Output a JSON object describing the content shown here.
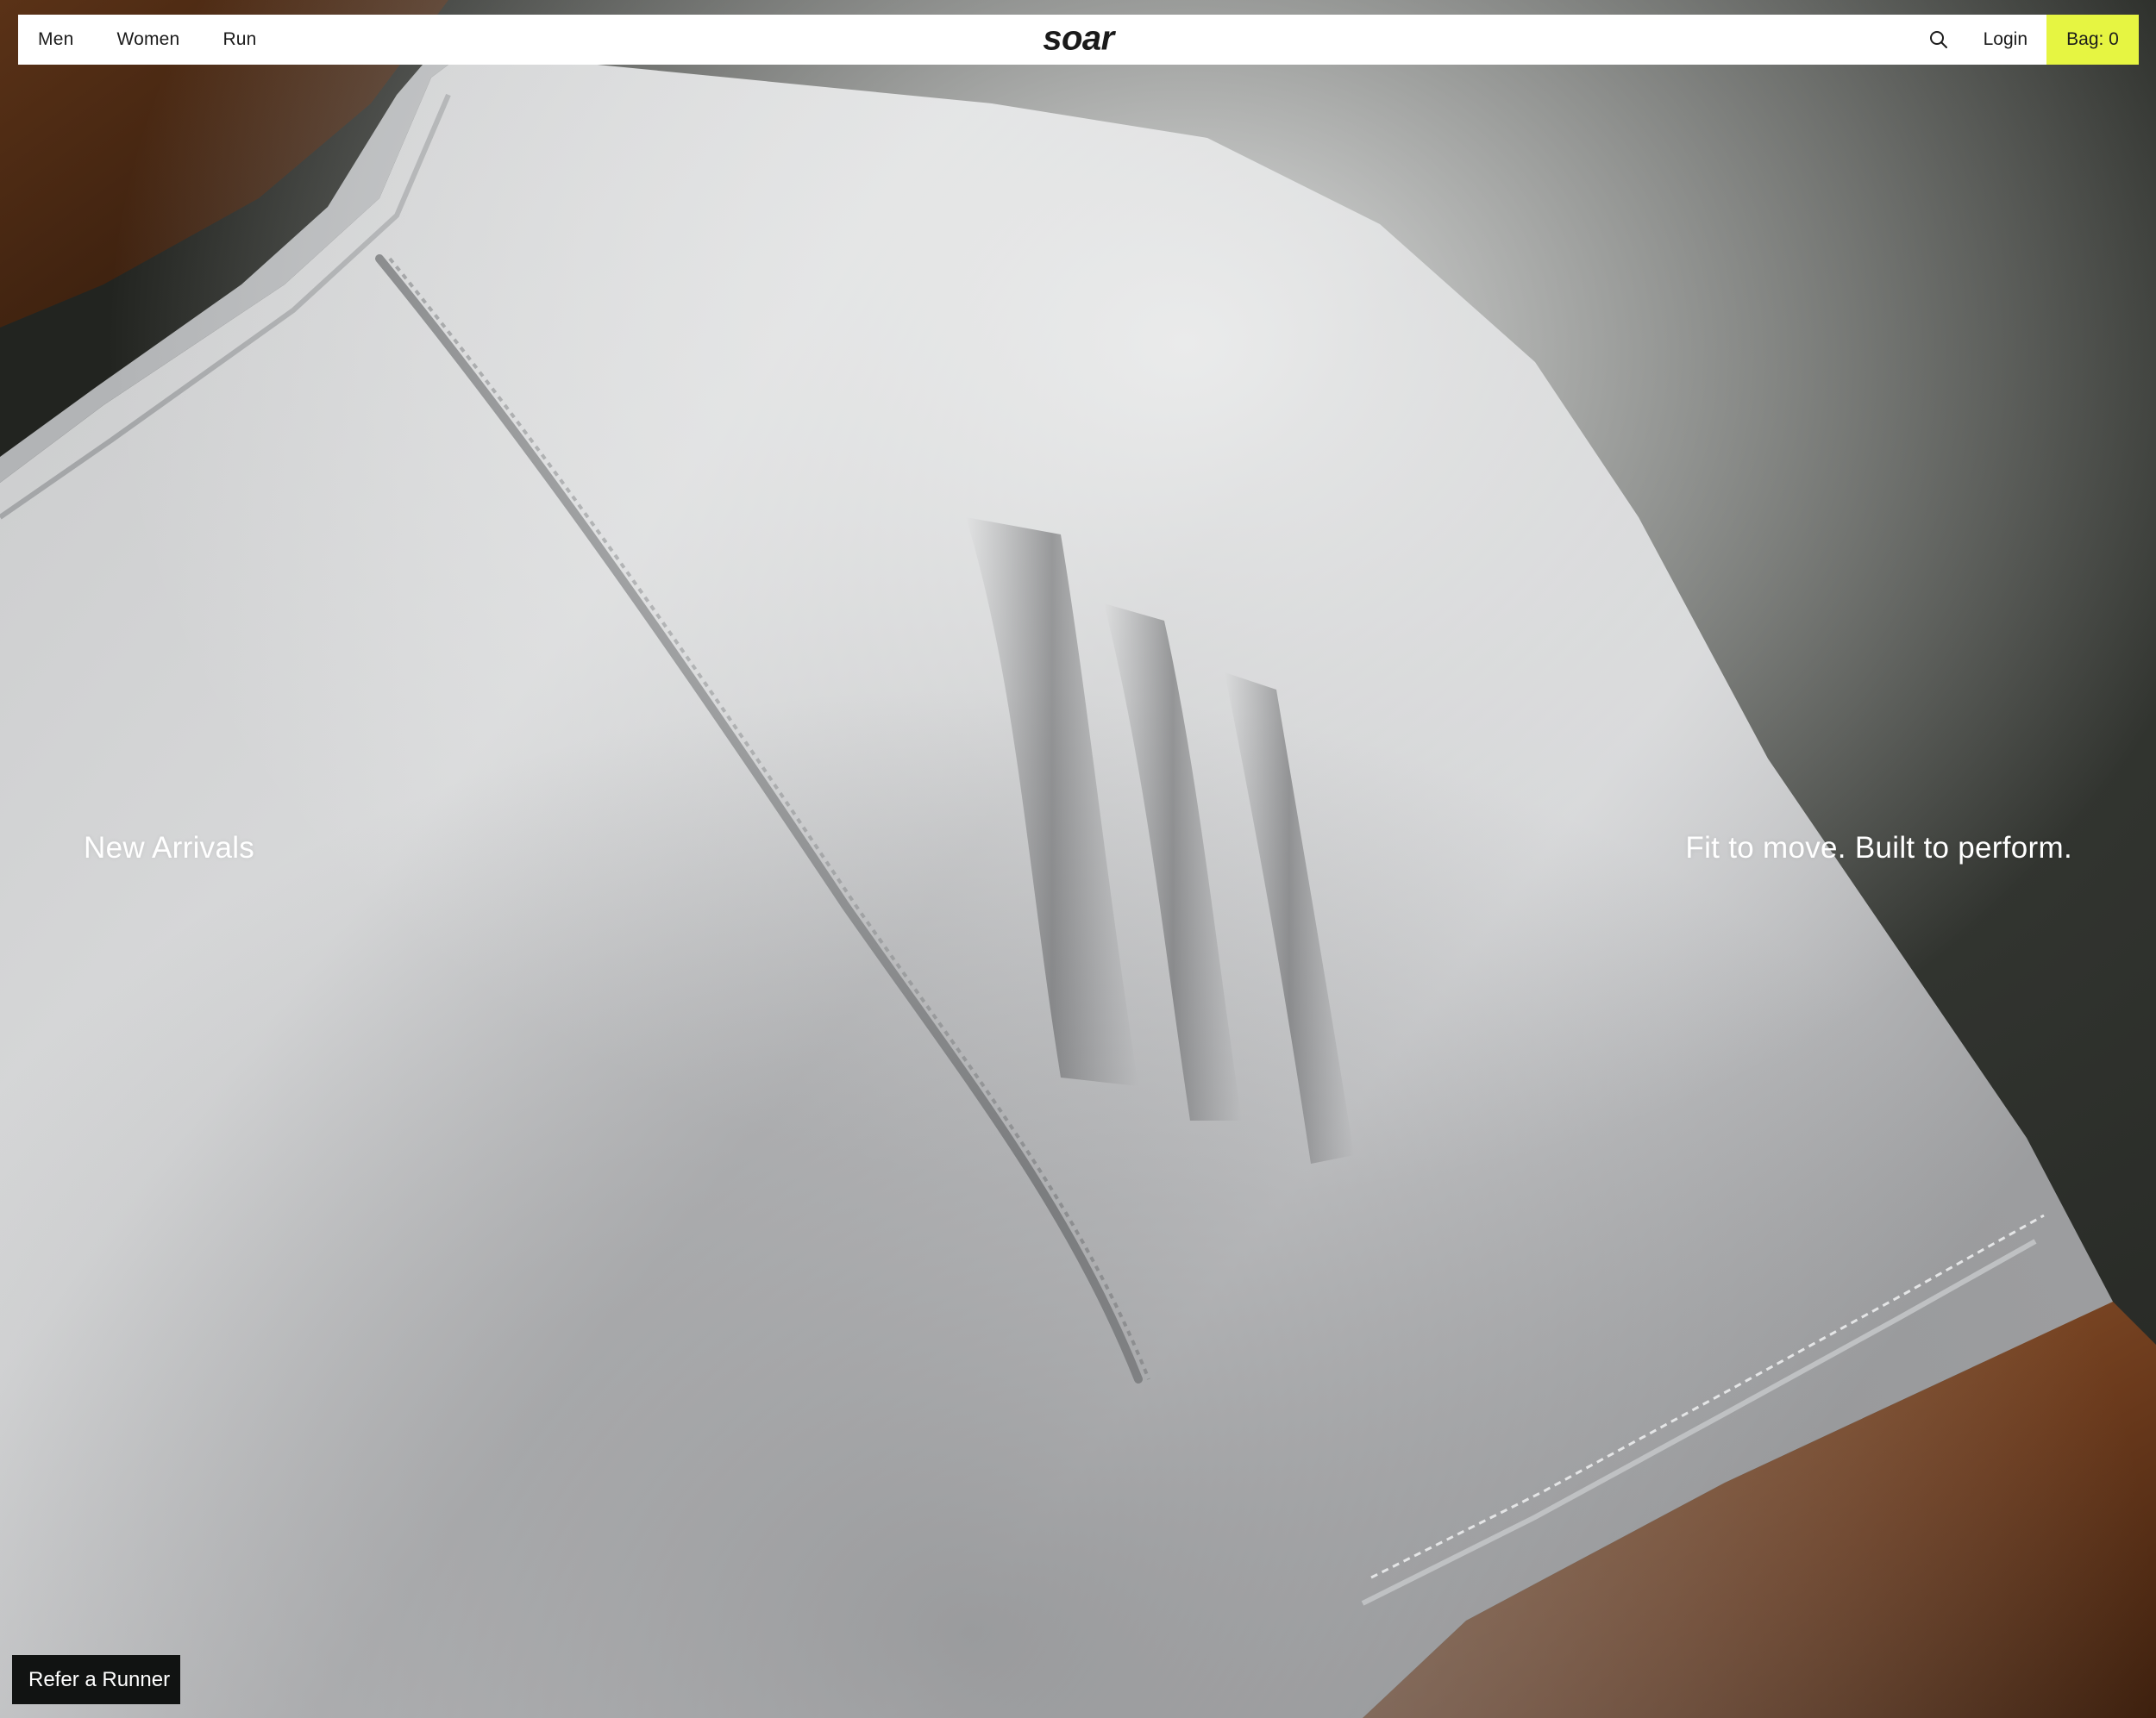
{
  "nav": {
    "links": [
      "Men",
      "Women",
      "Run"
    ],
    "logo": "soar",
    "login_label": "Login",
    "bag_label": "Bag: 0",
    "search_icon": "search-icon",
    "bag_color": "#e6f542"
  },
  "hero": {
    "left_text": "New Arrivals",
    "right_text": "Fit to move. Built to perform.",
    "image": "close-up of runner's shoulder in grey merino t-shirt"
  },
  "refer": {
    "label": "Refer a Runner"
  }
}
